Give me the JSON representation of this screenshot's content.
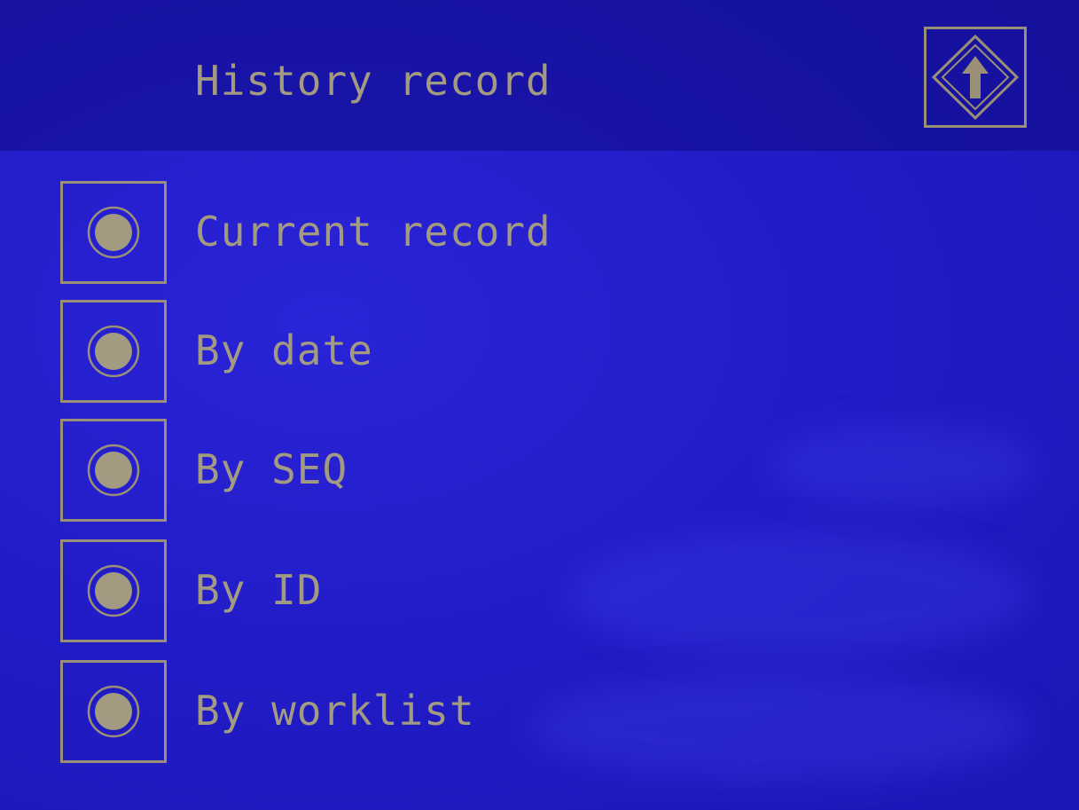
{
  "header": {
    "title": "History record",
    "up_icon": "up-arrow-icon"
  },
  "menu": {
    "items": [
      {
        "label": "Current record",
        "icon": "radio-icon"
      },
      {
        "label": "By date",
        "icon": "radio-icon"
      },
      {
        "label": "By SEQ",
        "icon": "radio-icon"
      },
      {
        "label": "By ID",
        "icon": "radio-icon"
      },
      {
        "label": "By worklist",
        "icon": "radio-icon"
      }
    ]
  },
  "colors": {
    "screen_background": "#221cc8",
    "foreground": "#a39a82",
    "frame": "#9a9078"
  }
}
